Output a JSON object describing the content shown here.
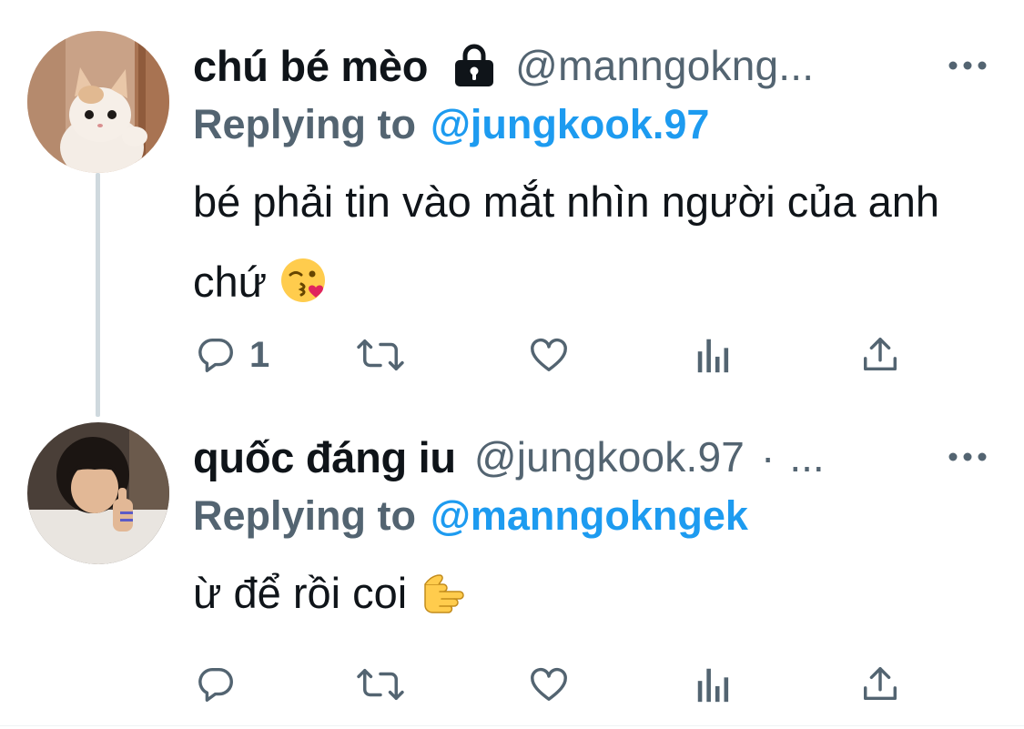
{
  "thread": [
    {
      "display_name": "chú bé mèo",
      "handle": "@manngokng...",
      "protected": true,
      "replying_label": "Replying to",
      "replying_to": "@jungkook.97",
      "text": "bé phải tin vào mắt nhìn người của anh chứ",
      "emoji": "face-blowing-a-kiss",
      "reply_count": "1",
      "avatar": "kitten-photo"
    },
    {
      "display_name": "quốc đáng iu",
      "handle": "@jungkook.97",
      "separator": "·",
      "trailing": "...",
      "replying_label": "Replying to",
      "replying_to": "@manngokngek",
      "text": "ừ để rồi coi",
      "emoji": "backhand-index-pointing-right",
      "reply_count": "",
      "avatar": "person-thumbs-up-photo"
    }
  ],
  "colors": {
    "text_primary": "#0f1419",
    "text_secondary": "#536471",
    "accent_blue": "#1d9bf0",
    "thread_line": "#cfd9de",
    "background": "#ffffff"
  },
  "icons": {
    "reply": "reply-icon",
    "retweet": "retweet-icon",
    "like": "like-icon",
    "analytics": "analytics-icon",
    "share": "share-icon",
    "more": "more-icon",
    "lock": "lock-icon"
  }
}
